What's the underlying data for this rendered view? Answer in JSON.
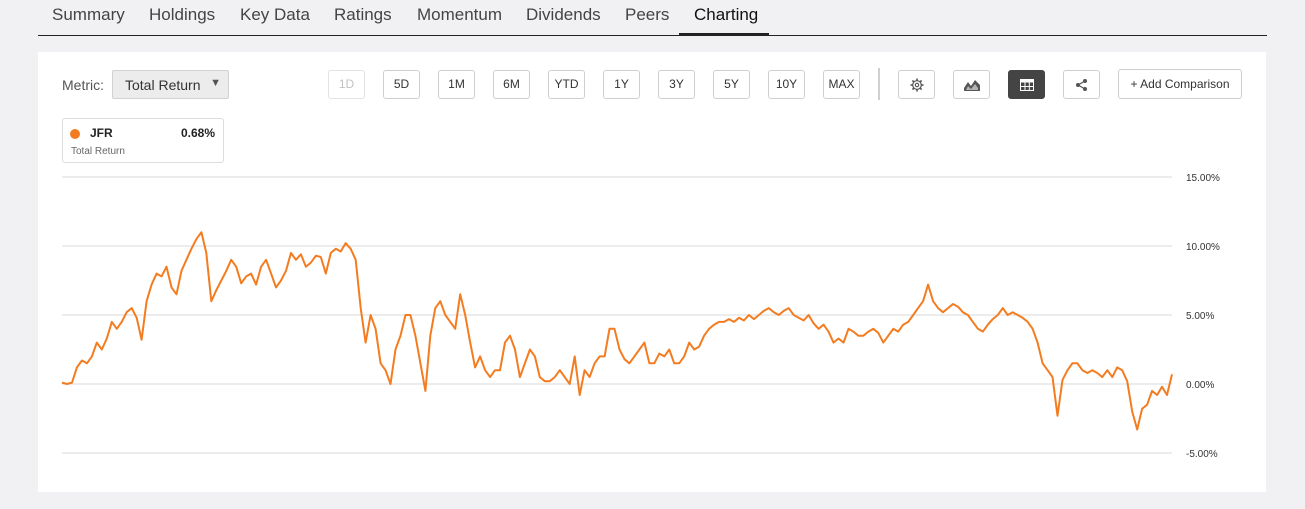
{
  "tabs": [
    {
      "label": "Summary",
      "active": false
    },
    {
      "label": "Holdings",
      "active": false
    },
    {
      "label": "Key Data",
      "active": false
    },
    {
      "label": "Ratings",
      "active": false
    },
    {
      "label": "Momentum",
      "active": false
    },
    {
      "label": "Dividends",
      "active": false
    },
    {
      "label": "Peers",
      "active": false
    },
    {
      "label": "Charting",
      "active": true
    }
  ],
  "toolbar": {
    "metric_label": "Metric:",
    "metric_value": "Total Return",
    "ranges": [
      {
        "label": "1D",
        "disabled": true
      },
      {
        "label": "5D",
        "disabled": false
      },
      {
        "label": "1M",
        "disabled": false
      },
      {
        "label": "6M",
        "disabled": false
      },
      {
        "label": "YTD",
        "disabled": false
      },
      {
        "label": "1Y",
        "disabled": false
      },
      {
        "label": "3Y",
        "disabled": false
      },
      {
        "label": "5Y",
        "disabled": false
      },
      {
        "label": "10Y",
        "disabled": false
      },
      {
        "label": "MAX",
        "disabled": false
      }
    ],
    "icons": [
      "gear-icon",
      "mountain-chart-icon",
      "table-icon",
      "share-icon"
    ],
    "active_icon": "table-icon",
    "add_comparison_label": "+ Add Comparison"
  },
  "legend": {
    "ticker": "JFR",
    "value": "0.68%",
    "metric": "Total Return",
    "color": "#f47c20"
  },
  "chart_data": {
    "type": "line",
    "title": "",
    "xlabel": "",
    "ylabel": "",
    "ylim": [
      -5,
      15
    ],
    "yticks": [
      15,
      10,
      5,
      0,
      -5
    ],
    "ytick_labels": [
      "15.00%",
      "10.00%",
      "5.00%",
      "0.00%",
      "-5.00%"
    ],
    "grid": true,
    "series": [
      {
        "name": "JFR",
        "color": "#f47c20",
        "values": [
          0.1,
          0.0,
          0.1,
          1.2,
          1.7,
          1.5,
          2.0,
          3.0,
          2.5,
          3.3,
          4.5,
          4.0,
          4.5,
          5.2,
          5.5,
          4.8,
          3.2,
          6.0,
          7.2,
          8.0,
          7.8,
          8.5,
          7.0,
          6.5,
          8.2,
          9.0,
          9.8,
          10.5,
          11.0,
          9.5,
          6.0,
          6.8,
          7.5,
          8.2,
          9.0,
          8.5,
          7.3,
          7.8,
          8.0,
          7.2,
          8.5,
          9.0,
          8.0,
          7.0,
          7.5,
          8.2,
          9.5,
          9.0,
          9.4,
          8.5,
          8.8,
          9.3,
          9.2,
          8.0,
          9.5,
          9.8,
          9.6,
          10.2,
          9.8,
          9.0,
          5.5,
          3.0,
          5.0,
          4.0,
          1.5,
          1.0,
          0.0,
          2.5,
          3.5,
          5.0,
          5.0,
          3.5,
          1.5,
          -0.5,
          3.5,
          5.5,
          6.0,
          5.0,
          4.5,
          4.0,
          6.5,
          5.0,
          3.0,
          1.2,
          2.0,
          1.0,
          0.5,
          1.0,
          1.0,
          3.0,
          3.5,
          2.5,
          0.5,
          1.5,
          2.5,
          2.0,
          0.5,
          0.2,
          0.2,
          0.5,
          1.0,
          0.5,
          0.0,
          2.0,
          -0.8,
          1.0,
          0.5,
          1.5,
          2.0,
          2.0,
          4.0,
          4.0,
          2.5,
          1.8,
          1.5,
          2.0,
          2.5,
          3.0,
          1.5,
          1.5,
          2.2,
          2.0,
          2.5,
          1.5,
          1.5,
          2.0,
          3.0,
          2.5,
          2.7,
          3.5,
          4.0,
          4.3,
          4.5,
          4.5,
          4.7,
          4.5,
          4.8,
          4.6,
          5.0,
          4.7,
          5.0,
          5.3,
          5.5,
          5.2,
          5.0,
          5.3,
          5.5,
          5.0,
          4.8,
          4.6,
          5.0,
          4.4,
          4.0,
          4.3,
          3.8,
          3.0,
          3.3,
          3.0,
          4.0,
          3.8,
          3.5,
          3.5,
          3.8,
          4.0,
          3.7,
          3.0,
          3.5,
          4.0,
          3.8,
          4.3,
          4.5,
          5.0,
          5.5,
          6.0,
          7.2,
          6.0,
          5.5,
          5.2,
          5.5,
          5.8,
          5.6,
          5.2,
          5.0,
          4.5,
          4.0,
          3.8,
          4.3,
          4.7,
          5.0,
          5.5,
          5.0,
          5.2,
          5.0,
          4.8,
          4.5,
          4.0,
          3.0,
          1.5,
          1.0,
          0.5,
          -2.3,
          0.3,
          1.0,
          1.5,
          1.5,
          1.0,
          0.8,
          1.0,
          0.8,
          0.5,
          1.0,
          0.5,
          1.2,
          1.0,
          0.2,
          -2.0,
          -3.3,
          -1.8,
          -1.5,
          -0.5,
          -0.8,
          -0.2,
          -0.8,
          0.7
        ]
      }
    ]
  }
}
